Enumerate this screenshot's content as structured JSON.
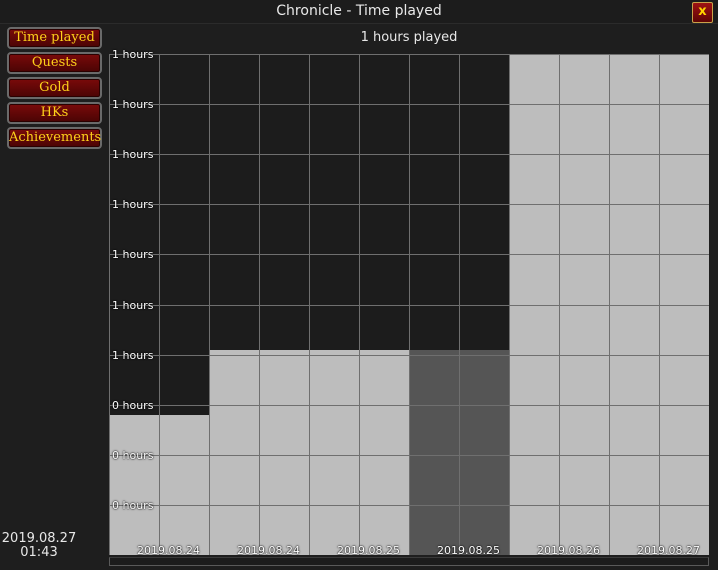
{
  "window": {
    "title": "Chronicle - Time played",
    "close_label": "x"
  },
  "menu": [
    {
      "label": "Time played"
    },
    {
      "label": "Quests"
    },
    {
      "label": "Gold"
    },
    {
      "label": "HKs"
    },
    {
      "label": "Achievements"
    }
  ],
  "clock": {
    "date": "2019.08.27",
    "time": "01:43"
  },
  "chart_data": {
    "type": "bar",
    "title": "1 hours played",
    "categories": [
      "2019.08.24",
      "2019.08.24",
      "2019.08.25",
      "2019.08.25",
      "2019.08.26",
      "2019.08.27"
    ],
    "values": [
      0.28,
      0.41,
      0.41,
      0.41,
      1.0,
      1.0
    ],
    "ylim": [
      0,
      1
    ],
    "ytick_labels": [
      "1 hours",
      "1 hours",
      "1 hours",
      "1 hours",
      "1 hours",
      "1 hours",
      "1 hours",
      "0 hours",
      "0 hours",
      "0 hours"
    ],
    "grid": true,
    "bar_colors": [
      "#bdbdbd",
      "#bdbdbd",
      "#bdbdbd",
      "#555555",
      "#bdbdbd",
      "#bdbdbd"
    ]
  }
}
